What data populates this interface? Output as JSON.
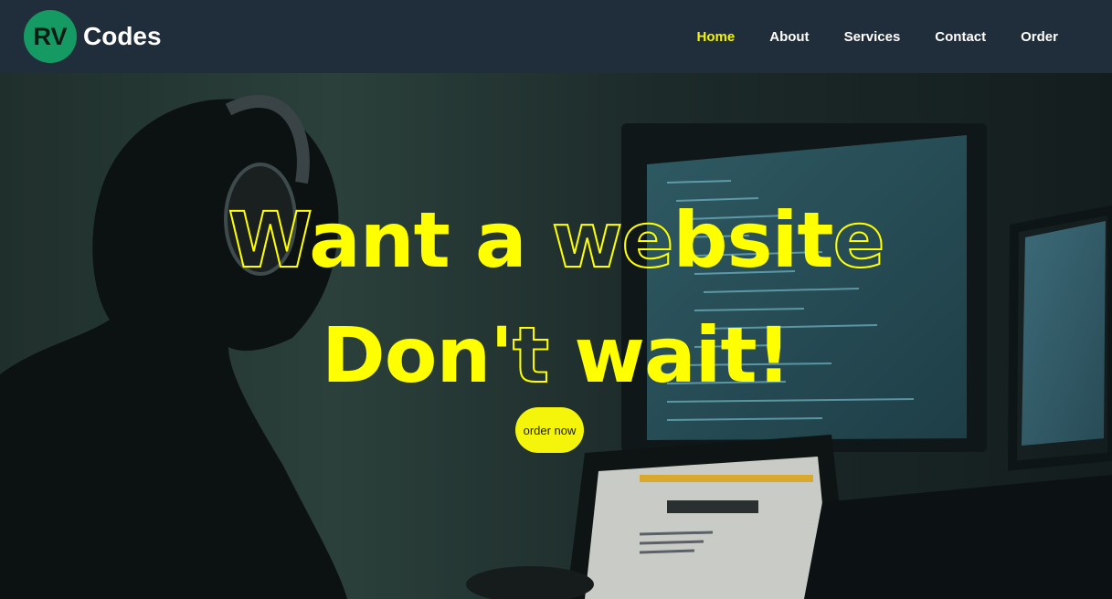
{
  "brand": {
    "logo_text": "RV",
    "name": "Codes"
  },
  "nav": {
    "items": [
      {
        "label": "Home",
        "active": true
      },
      {
        "label": "About",
        "active": false
      },
      {
        "label": "Services",
        "active": false
      },
      {
        "label": "Contact",
        "active": false
      },
      {
        "label": "Order",
        "active": false
      }
    ]
  },
  "hero": {
    "line1_parts": [
      "W",
      "ant a ",
      "we",
      "bsit",
      "e"
    ],
    "line2_parts": [
      "Don'",
      "t",
      " wait!"
    ],
    "cta_label": "order now"
  },
  "colors": {
    "navbar_bg": "#202d3b",
    "accent_yellow": "#ffff00",
    "logo_green": "#169a64",
    "nav_text": "#ffffff"
  }
}
